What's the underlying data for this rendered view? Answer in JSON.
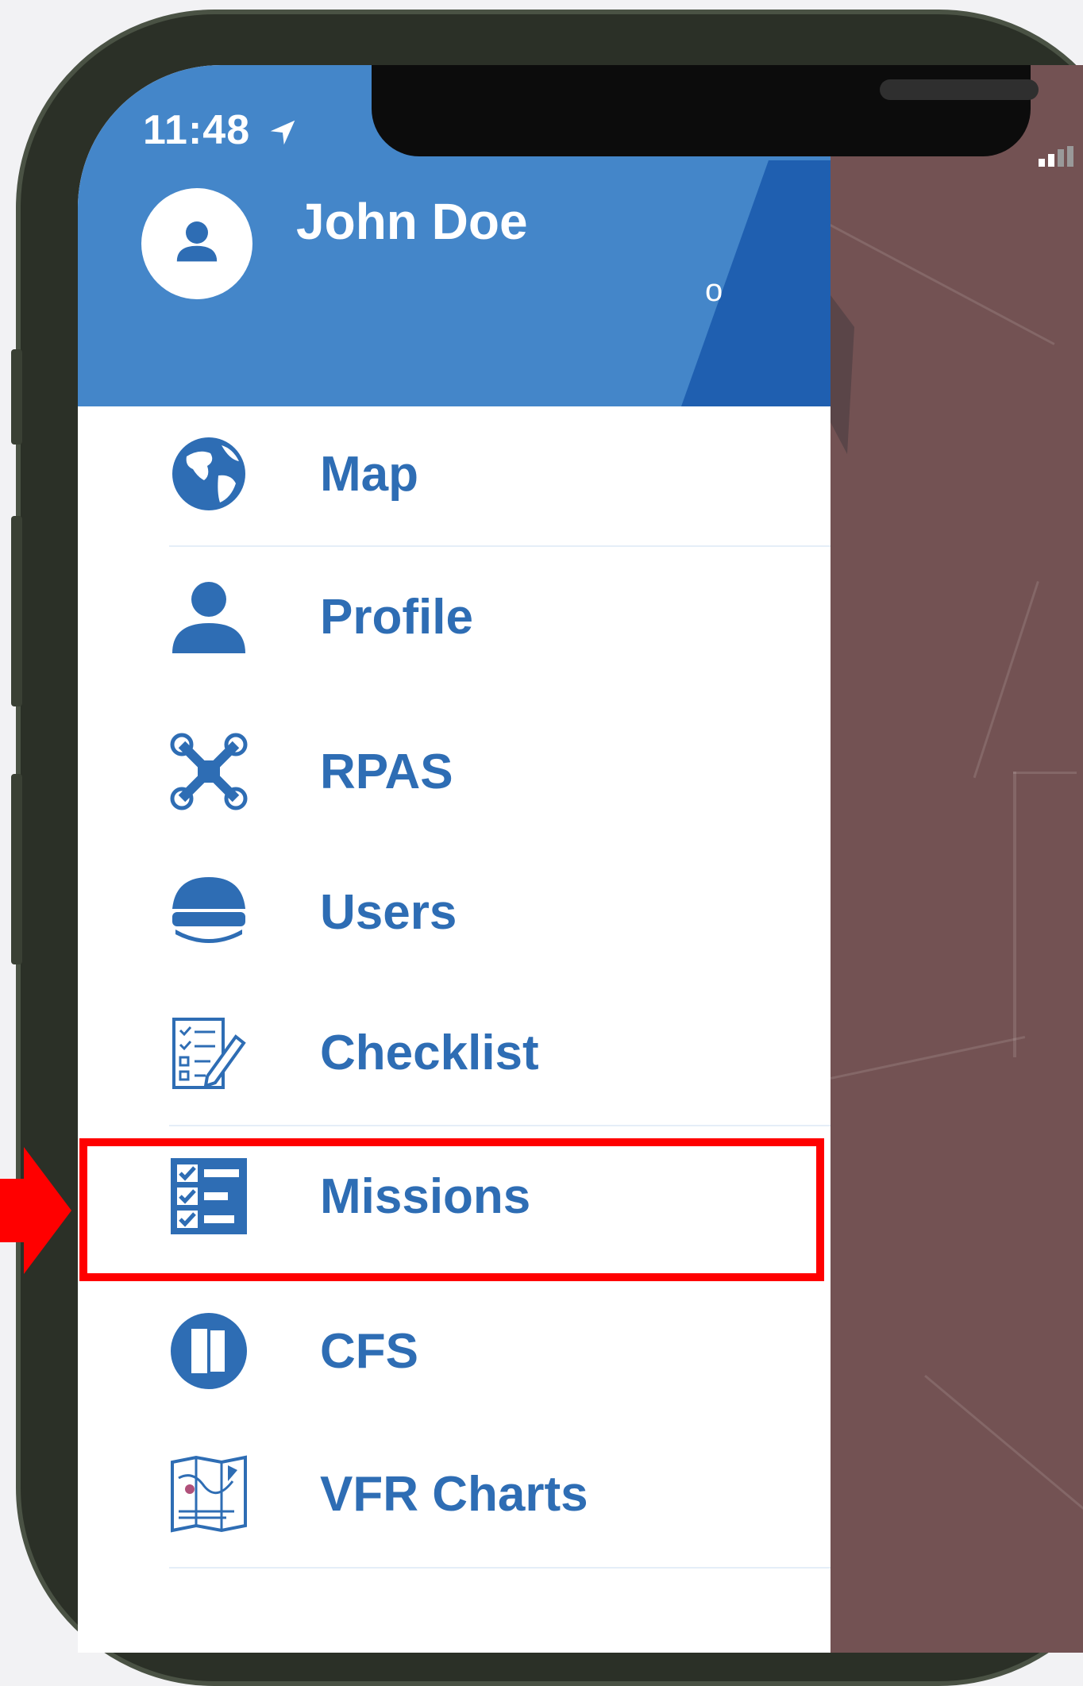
{
  "status_bar": {
    "time": "11:48"
  },
  "header": {
    "user_name": "John Doe",
    "user_subtitle": "o"
  },
  "menu": {
    "items": [
      {
        "label": "Map",
        "icon": "globe-icon"
      },
      {
        "label": "Profile",
        "icon": "person-icon"
      },
      {
        "label": "RPAS",
        "icon": "drone-icon"
      },
      {
        "label": "Users",
        "icon": "pilot-cap-icon"
      },
      {
        "label": "Checklist",
        "icon": "checklist-icon"
      },
      {
        "label": "Missions",
        "icon": "missions-icon",
        "highlighted": true
      },
      {
        "label": "CFS",
        "icon": "cfs-book-icon"
      },
      {
        "label": "VFR Charts",
        "icon": "vfr-chart-icon"
      }
    ]
  },
  "colors": {
    "header_blue": "#4486c9",
    "header_dark_blue": "#1f5fb0",
    "menu_text": "#2e6db4",
    "highlight": "#ff0000",
    "map_overlay": "#735253"
  }
}
